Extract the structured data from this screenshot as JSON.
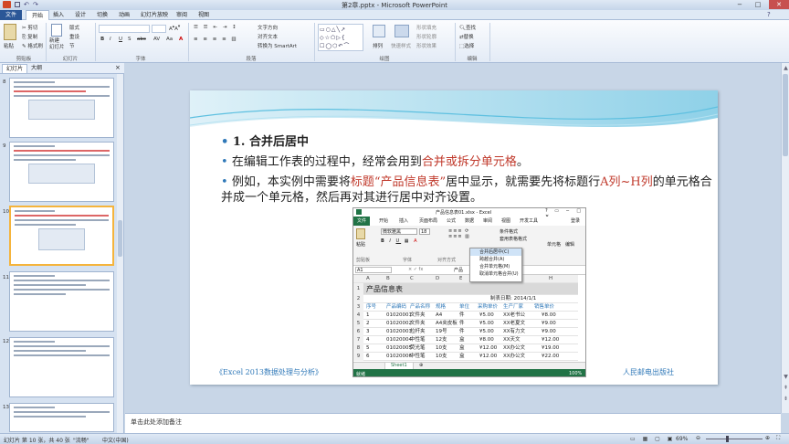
{
  "window": {
    "title": "第2章.pptx - Microsoft PowerPoint",
    "controls": {
      "minimize": "−",
      "maximize": "□",
      "close": "✕"
    }
  },
  "ribbon_tabs": [
    "文件",
    "开始",
    "插入",
    "设计",
    "切换",
    "动画",
    "幻灯片放映",
    "审阅",
    "视图"
  ],
  "ribbon": {
    "paste": "粘贴",
    "cut": "剪切",
    "copy": "复制",
    "format_painter": "格式刷",
    "new_slide": "新建\n幻灯片",
    "layout": "版式",
    "reset": "重设",
    "section": "节",
    "text_direction": "文字方向",
    "align_text": "对齐文本",
    "convert_smartart": "转换为 SmartArt",
    "arrange": "排列",
    "quick_styles": "快速样式",
    "shape_fill": "形状填充",
    "shape_outline": "形状轮廓",
    "shape_effects": "形状效果",
    "find": "查找",
    "replace": "替换",
    "select": "选择",
    "groups": [
      "剪贴板",
      "幻灯片",
      "字体",
      "段落",
      "绘图",
      "编辑"
    ]
  },
  "panel": {
    "tabs": [
      "幻灯片",
      "大纲"
    ],
    "thumb_numbers": [
      "8",
      "9",
      "10",
      "11",
      "12",
      "13"
    ],
    "selected": "10",
    "close": "×"
  },
  "slide": {
    "bullet1": "1. 合并后居中",
    "bullet2_a": "在编辑工作表的过程中，经常会用到",
    "bullet2_red": "合并或拆分单元格",
    "bullet2_b": "。",
    "bullet3_a": "例如，本实例中需要将",
    "bullet3_red1": "标题“产品信息表”",
    "bullet3_b": "居中显示，就需要先将标题行",
    "bullet3_red2": "A列~H列",
    "bullet3_c": "的单元格合并成一个单元格，然后再对其进行居中对齐设置。",
    "footer_left": "《Excel 2013数据处理与分析》",
    "footer_right": "人民邮电出版社"
  },
  "excel": {
    "title": "产品信息表01.xlsx - Excel",
    "login": "登录",
    "tabs": [
      "开始",
      "插入",
      "页面布局",
      "公式",
      "数据",
      "审阅",
      "视图",
      "开发工具"
    ],
    "file_tab": "文件",
    "font_name": "微软雅黑",
    "font_size": "18",
    "paste": "粘贴",
    "clipboard": "剪贴板",
    "font_group": "字体",
    "align_group": "对齐方式",
    "cond_format": "条件格式",
    "table_format": "套用表格格式",
    "cell_group": "单元格",
    "edit_group": "编辑",
    "menu": [
      "合并后居中(C)",
      "跨越合并(A)",
      "合并单元格(M)",
      "取消单元格合并(U)"
    ],
    "name_box": "A1",
    "formula": "产品",
    "columns": [
      "A",
      "B",
      "C",
      "D",
      "E",
      "F",
      "G",
      "H"
    ],
    "rows": [
      {
        "n": "1",
        "cells": [
          "产品信息表"
        ]
      },
      {
        "n": "2",
        "cells": [
          "制表日期: 2014/1/1"
        ]
      },
      {
        "n": "3",
        "cells": [
          "序号",
          "产品编码",
          "产品名称",
          "规格",
          "单位",
          "采购单价",
          "生产厂家",
          "销售单价"
        ]
      },
      {
        "n": "4",
        "cells": [
          "1",
          "01020001",
          "文件夹",
          "A4",
          "件",
          "¥5.00",
          "XX老书公",
          "¥8.00"
        ]
      },
      {
        "n": "5",
        "cells": [
          "2",
          "01020002",
          "文件夹",
          "A4夹皮板",
          "件",
          "¥5.00",
          "XX老夏文",
          "¥9.00"
        ]
      },
      {
        "n": "6",
        "cells": [
          "3",
          "01020003",
          "拉杆夹",
          "19号",
          "件",
          "¥5.00",
          "XX有力文",
          "¥9.00"
        ]
      },
      {
        "n": "7",
        "cells": [
          "4",
          "01020004",
          "中性笔",
          "12支",
          "盒",
          "¥8.00",
          "XX天文",
          "¥12.00"
        ]
      },
      {
        "n": "8",
        "cells": [
          "5",
          "01020005",
          "荧光笔",
          "10支",
          "盒",
          "¥12.00",
          "XX办公文",
          "¥19.00"
        ]
      },
      {
        "n": "9",
        "cells": [
          "6",
          "01020006",
          "中性笔",
          "10支",
          "盒",
          "¥12.00",
          "XX办公文",
          "¥22.00"
        ]
      }
    ],
    "sheet": "Sheet1",
    "status_ready": "就绪",
    "zoom": "100%"
  },
  "notes_placeholder": "单击此处添加备注",
  "statusbar": {
    "slide_info": "幻灯片 第 10 张，共 40 张",
    "theme": "\"流畅\"",
    "language": "中文(中国)",
    "zoom": "69%"
  }
}
